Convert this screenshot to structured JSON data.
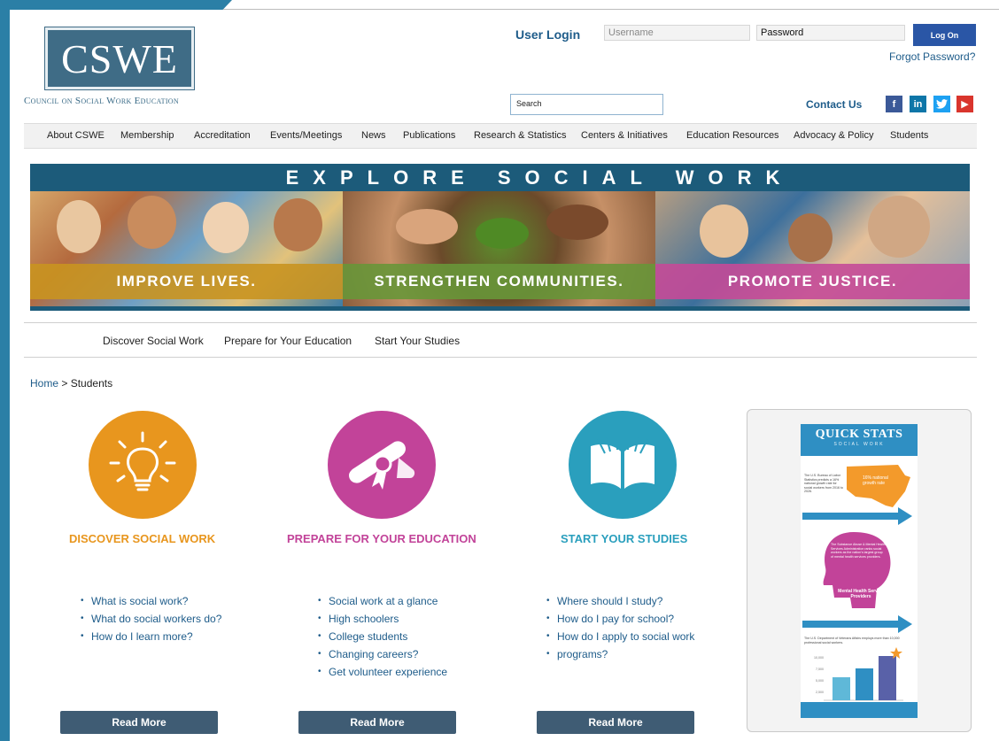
{
  "header": {
    "logo_text": "CSWE",
    "logo_tagline": "Council on Social Work Education",
    "login_title": "User Login",
    "username_placeholder": "Username",
    "password_label": "Password",
    "logon_label": "Log On",
    "forgot_label": "Forgot Password?",
    "search_placeholder": "Search",
    "contact_label": "Contact Us",
    "social": [
      {
        "label": "f",
        "icon": "facebook-icon"
      },
      {
        "label": "in",
        "icon": "linkedin-icon"
      },
      {
        "label": "t",
        "icon": "twitter-icon"
      },
      {
        "label": "▶",
        "icon": "youtube-icon"
      }
    ]
  },
  "nav": [
    "About CSWE",
    "Membership",
    "Accreditation",
    "Events/Meetings",
    "News",
    "Publications",
    "Research & Statistics",
    "Centers & Initiatives",
    "Education Resources",
    "Advocacy & Policy",
    "Students"
  ],
  "banner": {
    "title": "EXPLORE SOCIAL WORK",
    "captions": [
      "IMPROVE LIVES.",
      "STRENGTHEN COMMUNITIES.",
      "PROMOTE JUSTICE."
    ]
  },
  "subnav": [
    "Discover Social Work",
    "Prepare for Your Education",
    "Start Your Studies"
  ],
  "breadcrumb": {
    "home": "Home",
    "separator": " > ",
    "current": "Students"
  },
  "columns": [
    {
      "title": "DISCOVER SOCIAL WORK",
      "color": "#e8961e",
      "icon": "lightbulb-icon",
      "links": [
        "What is social work?",
        "What do social workers do?",
        "How do I learn more?"
      ],
      "button": "Read More"
    },
    {
      "title": "PREPARE FOR YOUR EDUCATION",
      "color": "#c24399",
      "icon": "diploma-icon",
      "links": [
        "Social work at a glance",
        "High schoolers",
        "College students",
        "Changing careers?",
        "Get volunteer experience"
      ],
      "button": "Read More"
    },
    {
      "title": "START YOUR STUDIES",
      "color": "#2a9fbd",
      "icon": "open-book-icon",
      "links": [
        "Where should I study?",
        "How do I pay for school?",
        "How do I apply to social work",
        "programs?"
      ],
      "button": "Read More"
    }
  ],
  "quick_stats": {
    "title": "QUICK STATS",
    "subtitle": "SOCIAL WORK",
    "stat1_text": "The U.S. Bureau of Labor Statistics predicts a 16% national growth rate for social workers from 2016 to 2026.",
    "stat1_map_label": "16% national growth rate",
    "stat2_text": "The Substance Abuse & Mental Health Services Administration ranks social workers as the nation's largest group of mental health services providers.",
    "stat2_head_label": "Mental Health Service Providers",
    "stat3_text": "The U.S. Department of Veterans Affairs employs more than 10,000 professional social workers.",
    "stat3_ticks": [
      "10,000",
      "7,500",
      "5,000",
      "2,500"
    ]
  }
}
